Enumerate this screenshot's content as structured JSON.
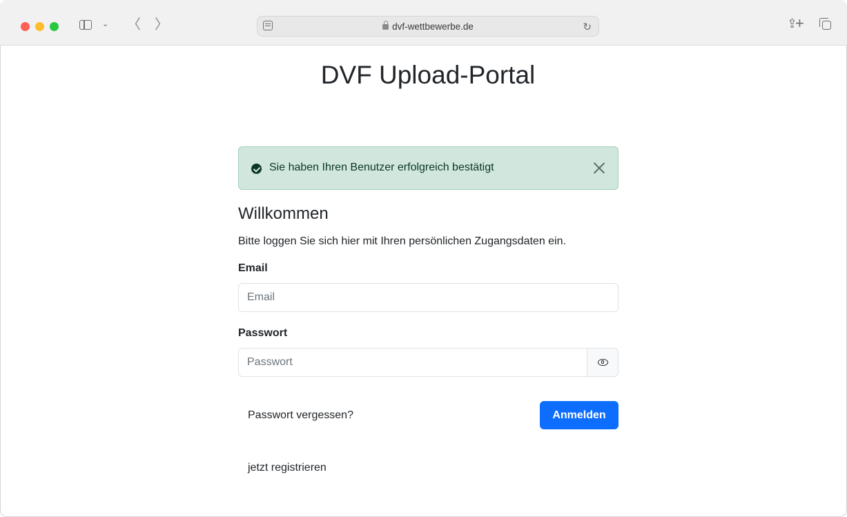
{
  "browser": {
    "url": "dvf-wettbewerbe.de",
    "icons": {
      "sidebar": "sidebar-icon",
      "chevron": "chevron-down-icon",
      "back": "chevron-left-icon",
      "forward": "chevron-right-icon",
      "reader": "reader-icon",
      "lock": "lock-icon",
      "reload": "reload-icon",
      "share": "share-icon",
      "new_tab": "plus-icon",
      "tabs": "tabs-overview-icon"
    },
    "glyphs": {
      "chevron": "⌄",
      "back": "〈",
      "forward": "〉",
      "reload": "↻",
      "share": "⇪",
      "plus": "+"
    }
  },
  "page": {
    "title": "DVF Upload-Portal",
    "alert": {
      "message": "Sie haben Ihren Benutzer erfolgreich bestätigt",
      "color_bg": "#d1e7dd",
      "color_text": "#0a3622"
    },
    "welcome_heading": "Willkommen",
    "intro_text": "Bitte loggen Sie sich hier mit Ihren persönlichen Zugangsdaten ein.",
    "email": {
      "label": "Email",
      "placeholder": "Email",
      "value": ""
    },
    "password": {
      "label": "Passwort",
      "placeholder": "Passwort",
      "value": ""
    },
    "forgot_password_link": "Passwort vergessen?",
    "login_button": "Anmelden",
    "register_link": "jetzt registrieren",
    "accent_color": "#0d6efd"
  }
}
